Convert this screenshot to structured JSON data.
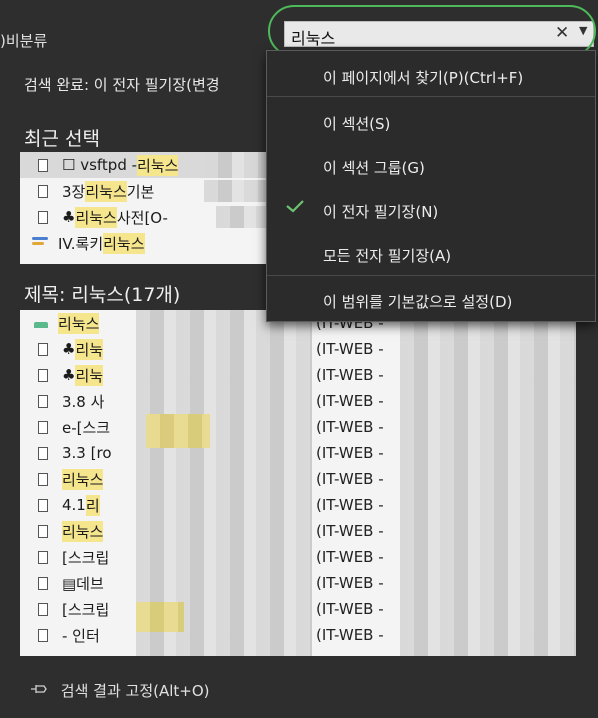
{
  "topbar": {
    "left_label": ")비분류"
  },
  "search": {
    "query": "리눅스",
    "clear_glyph": "✕",
    "dropdown_glyph": "▼"
  },
  "panel": {
    "status": "검색 완료:  이 전자 필기장(변경",
    "recent_title": "최근 선택",
    "recent_items": [
      {
        "pre": "☐ vsftpd - ",
        "hit": "리눅스"
      },
      {
        "pre": "3장 ",
        "hit": "리눅스",
        "post": " 기본"
      },
      {
        "pre": "♣",
        "hit": "리눅스",
        "post": "사전[O-"
      },
      {
        "pre": "IV.록키",
        "hit": "리눅스"
      }
    ],
    "results_title": "제목:  리눅스(17개)",
    "results": [
      {
        "pre": "",
        "hit": "리눅스",
        "post": " ",
        "notebook": "(IT-WEB -"
      },
      {
        "pre": "♣",
        "hit": "리눅",
        "post": "",
        "notebook": "(IT-WEB -"
      },
      {
        "pre": "♣",
        "hit": "리눅",
        "post": "",
        "notebook": "(IT-WEB -"
      },
      {
        "pre": "3.8 사",
        "hit": "",
        "post": "",
        "notebook": "(IT-WEB -"
      },
      {
        "pre": "e-[스크",
        "hit": "",
        "post": "",
        "notebook": "(IT-WEB -"
      },
      {
        "pre": "3.3 [ro",
        "hit": "",
        "post": "",
        "notebook": "(IT-WEB -"
      },
      {
        "pre": "",
        "hit": "리눅스",
        "post": "",
        "notebook": "(IT-WEB -"
      },
      {
        "pre": "4.1 ",
        "hit": "리",
        "post": "",
        "notebook": "(IT-WEB -"
      },
      {
        "pre": "",
        "hit": "리눅스",
        "post": "",
        "notebook": "(IT-WEB -"
      },
      {
        "pre": "[스크립",
        "hit": "",
        "post": "",
        "notebook": "(IT-WEB -"
      },
      {
        "pre": "▤데브",
        "hit": "",
        "post": "",
        "notebook": "(IT-WEB -"
      },
      {
        "pre": "[스크립",
        "hit": "",
        "post": "",
        "notebook": "(IT-WEB -"
      },
      {
        "pre": "- 인터",
        "hit": "",
        "post": "",
        "notebook": "(IT-WEB -"
      }
    ],
    "pin_label": "검색 결과 고정(Alt+O)"
  },
  "menu": {
    "find_on_page": "이 페이지에서 찾기(P)(Ctrl+F)",
    "this_section": "이 섹션(S)",
    "this_section_group": "이 섹션 그룹(G)",
    "this_notebook": "이 전자 필기장(N)",
    "all_notebooks": "모든 전자 필기장(A)",
    "set_default": "이 범위를 기본값으로 설정(D)"
  },
  "colors": {
    "highlight": "#f5e58c",
    "check": "#6cc36f",
    "focus_ring": "#4eb95a"
  }
}
